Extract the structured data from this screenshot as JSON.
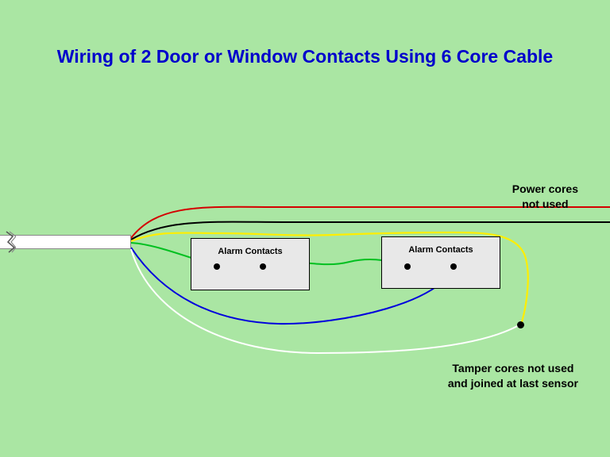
{
  "title": "Wiring of 2 Door or Window Contacts Using 6 Core Cable",
  "contactBox1": {
    "label": "Alarm Contacts"
  },
  "contactBox2": {
    "label": "Alarm Contacts"
  },
  "notes": {
    "power": "Power cores\nnot used",
    "tamper": "Tamper cores not used\nand joined at last sensor"
  },
  "wires": {
    "red": {
      "color": "#d40000"
    },
    "black": {
      "color": "#000000"
    },
    "yellow": {
      "color": "#ffee00"
    },
    "green": {
      "color": "#00c020"
    },
    "blue": {
      "color": "#0000dd"
    },
    "white": {
      "color": "#ffffff"
    }
  }
}
